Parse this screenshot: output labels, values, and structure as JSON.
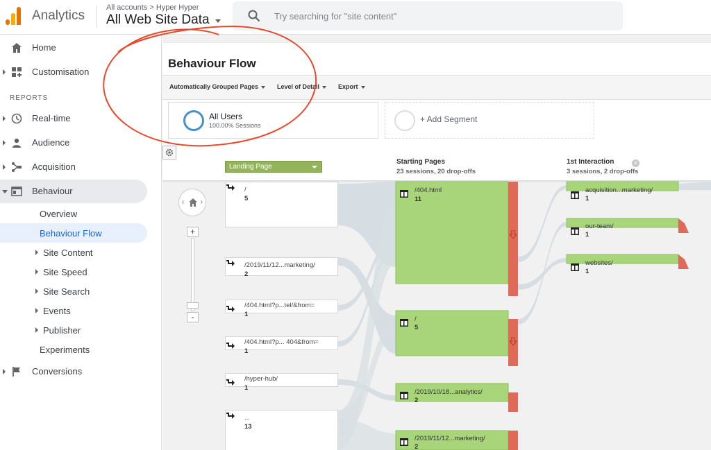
{
  "app": {
    "title": "Analytics",
    "account_crumb": "All accounts > Hyper Hyper",
    "view": "All Web Site Data"
  },
  "search": {
    "placeholder": "Try searching for \"site content\""
  },
  "sidebar": {
    "items": [
      {
        "label": "Home",
        "icon": "home-icon"
      },
      {
        "label": "Customisation",
        "icon": "dashboard-icon"
      }
    ],
    "reports_heading": "REPORTS",
    "reports": [
      {
        "label": "Real-time",
        "icon": "clock-icon"
      },
      {
        "label": "Audience",
        "icon": "person-icon"
      },
      {
        "label": "Acquisition",
        "icon": "acquisition-icon"
      },
      {
        "label": "Behaviour",
        "icon": "behaviour-icon"
      }
    ],
    "behaviour_sub": [
      {
        "label": "Overview"
      },
      {
        "label": "Behaviour Flow",
        "active": true
      },
      {
        "label": "Site Content"
      },
      {
        "label": "Site Speed"
      },
      {
        "label": "Site Search"
      },
      {
        "label": "Events"
      },
      {
        "label": "Publisher"
      },
      {
        "label": "Experiments"
      }
    ],
    "conversions": {
      "label": "Conversions",
      "icon": "flag-icon"
    }
  },
  "main": {
    "title": "Behaviour Flow",
    "toolbar": {
      "grouped": "Automatically Grouped Pages",
      "detail": "Level of Detail",
      "export": "Export"
    },
    "segments": {
      "all_users": {
        "name": "All Users",
        "sub": "100.00% Sessions"
      },
      "add": "+ Add Segment"
    }
  },
  "flow": {
    "dimension": "Landing Page",
    "starting": {
      "title": "Starting Pages",
      "sub": "23 sessions, 20 drop-offs"
    },
    "interaction": {
      "title": "1st Interaction",
      "sub": "3 sessions, 2 drop-offs"
    },
    "landing_pages": [
      {
        "name": "/",
        "count": "5"
      },
      {
        "name": "/2019/11/12...marketing/",
        "count": "2"
      },
      {
        "name": "/404.html?p...tel/&from=",
        "count": "1"
      },
      {
        "name": "/404.html?p... 404&from=",
        "count": "1"
      },
      {
        "name": "/hyper-hub/",
        "count": "1"
      },
      {
        "name": "...",
        "count": "13"
      }
    ],
    "starting_pages": [
      {
        "name": "/404.html",
        "count": "11"
      },
      {
        "name": "/",
        "count": "5"
      },
      {
        "name": "/2019/10/18...analytics/",
        "count": "2"
      },
      {
        "name": "/2019/11/12...marketing/",
        "count": "2"
      }
    ],
    "first_interaction": [
      {
        "name": "acquisition...marketing/",
        "count": "1"
      },
      {
        "name": "our-team/",
        "count": "1"
      },
      {
        "name": "websites/",
        "count": "1"
      }
    ],
    "colors": {
      "node_green": "#a8d47a",
      "dropoff_red": "#e06a5a",
      "flow_grey": "#d5dde2",
      "highlight": "#e8482c"
    }
  }
}
